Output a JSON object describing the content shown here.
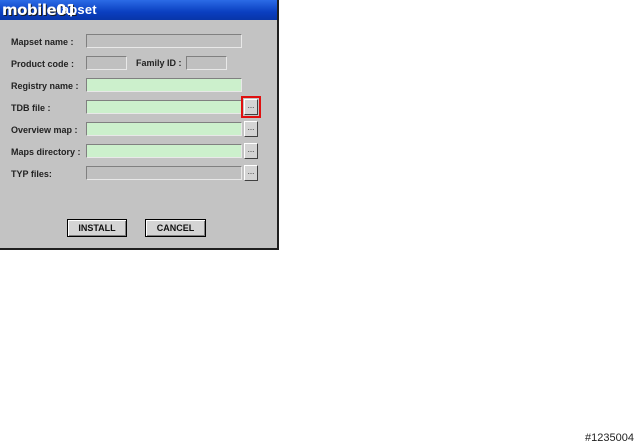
{
  "window": {
    "logo_text": "mobile01",
    "title": "lapset"
  },
  "form": {
    "mapset_name_label": "Mapset name :",
    "product_code_label": "Product code :",
    "family_id_label": "Family ID :",
    "registry_name_label": "Registry name :",
    "tdb_file_label": "TDB file :",
    "overview_map_label": "Overview map :",
    "maps_directory_label": "Maps directory :",
    "typ_files_label": "TYP files:",
    "browse_label": "..."
  },
  "buttons": {
    "install": "INSTALL",
    "cancel": "CANCEL"
  },
  "watermark": "#1235004",
  "colors": {
    "title_bar": "#0a3fc0",
    "field_active": "#ccf0cc",
    "highlight": "#e01010"
  }
}
